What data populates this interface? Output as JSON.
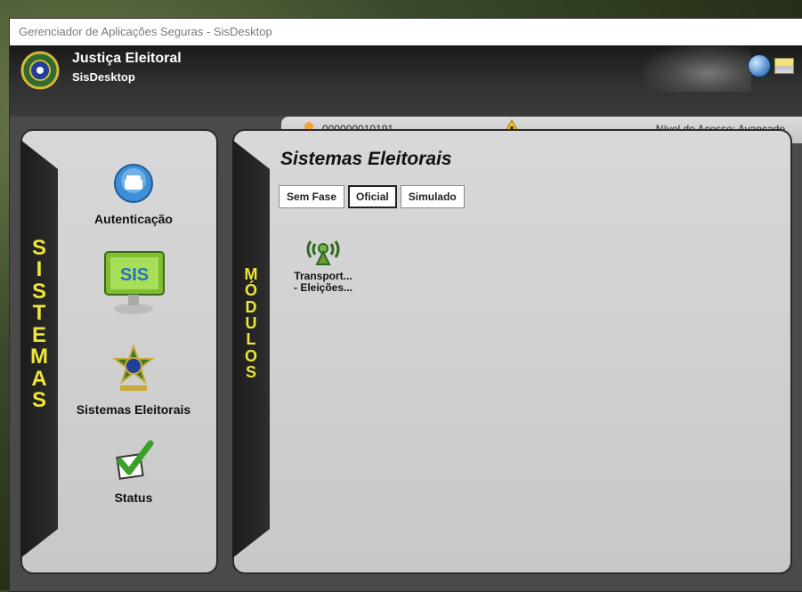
{
  "window": {
    "title": "Gerenciador de Aplicações Seguras - SisDesktop"
  },
  "header": {
    "brand_title": "Justiça Eleitoral",
    "brand_subtitle": "SisDesktop",
    "user_id": "000000010191",
    "access_level": "Nível de Acesso: Avançado",
    "icons": [
      "brasao-emblem-icon",
      "refresh-icon",
      "minimize-icon",
      "user-icon",
      "warning-icon"
    ]
  },
  "sidebar": {
    "tab_label": [
      "S",
      "I",
      "S",
      "T",
      "E",
      "M",
      "A",
      "S"
    ],
    "items": [
      {
        "label": "Autenticação",
        "icon": "telephone-icon"
      },
      {
        "label": "",
        "icon": "sis-monitor-icon"
      },
      {
        "label": "Sistemas Eleitorais",
        "icon": "brasao-emblem-icon"
      },
      {
        "label": "Status",
        "icon": "checkmark-icon"
      }
    ]
  },
  "modules": {
    "tab_label": [
      "M",
      "Ó",
      "D",
      "U",
      "L",
      "O",
      "S"
    ],
    "title": "Sistemas Eleitorais",
    "tabs": [
      {
        "label": "Sem Fase",
        "selected": false
      },
      {
        "label": "Oficial",
        "selected": true
      },
      {
        "label": "Simulado",
        "selected": false
      }
    ],
    "items": [
      {
        "label_line1": "Transport...",
        "label_line2": "- Eleições...",
        "icon": "antenna-transmission-icon"
      }
    ]
  },
  "colors": {
    "accent_yellow": "#f0e53a",
    "panel_gray": "#d0d0d0",
    "header_dark": "#2b2b2b"
  }
}
